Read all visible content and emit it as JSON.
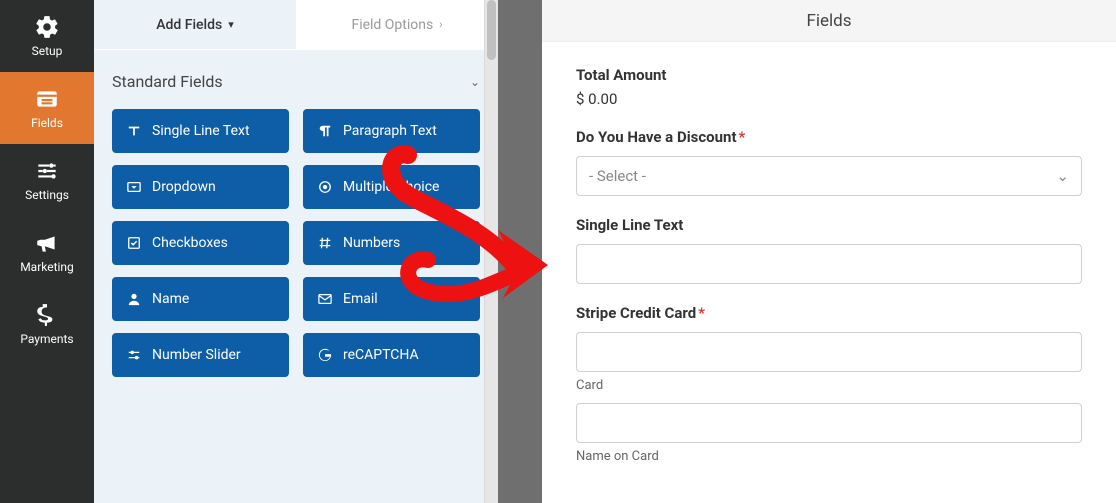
{
  "sidebar": {
    "items": [
      {
        "key": "setup",
        "label": "Setup"
      },
      {
        "key": "fields",
        "label": "Fields"
      },
      {
        "key": "settings",
        "label": "Settings"
      },
      {
        "key": "marketing",
        "label": "Marketing"
      },
      {
        "key": "payments",
        "label": "Payments"
      }
    ],
    "active": "fields"
  },
  "builder": {
    "tabs": {
      "add_fields": "Add Fields",
      "field_options": "Field Options"
    },
    "section_title": "Standard Fields",
    "fields": {
      "single_line_text": "Single Line Text",
      "paragraph_text": "Paragraph Text",
      "dropdown": "Dropdown",
      "multiple_choice": "Multiple Choice",
      "checkboxes": "Checkboxes",
      "numbers": "Numbers",
      "name": "Name",
      "email": "Email",
      "number_slider": "Number Slider",
      "recaptcha": "reCAPTCHA"
    }
  },
  "preview": {
    "header": "Fields",
    "total_label": "Total Amount",
    "total_value": "$ 0.00",
    "discount_label": "Do You Have a Discount",
    "discount_placeholder": "- Select -",
    "slt_label": "Single Line Text",
    "stripe_label": "Stripe Credit Card",
    "card_sub": "Card",
    "name_on_card_sub": "Name on Card"
  }
}
